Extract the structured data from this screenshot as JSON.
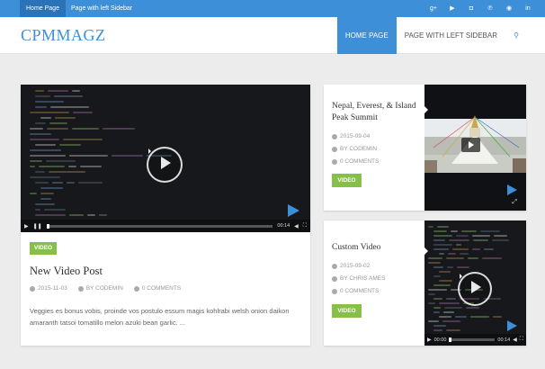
{
  "topbar": {
    "links": [
      "Home Page",
      "Page with left Sidebar"
    ],
    "social_icons": [
      "google-plus-icon",
      "youtube-icon",
      "instagram-icon",
      "pinterest-icon",
      "dribbble-icon",
      "linkedin-icon"
    ],
    "social_glyphs": [
      "g+",
      "▶",
      "◘",
      "℗",
      "◉",
      "in"
    ]
  },
  "header": {
    "logo": "CPMMAGZ",
    "nav": [
      "HOME PAGE",
      "PAGE WITH LEFT SIDEBAR"
    ],
    "search_glyph": "⚲"
  },
  "colors": {
    "accent": "#3d8fd8",
    "badge": "#86c04b"
  },
  "main_post": {
    "badge": "VIDEO",
    "title": "New Video Post",
    "date": "2015-11-03",
    "author": "BY CODEMIN",
    "comments": "0 COMMENTS",
    "excerpt": "Veggies es bonus vobis, proinde vos postulo essum magis kohlrabi welsh onion daikon amaranth tatsoi tomatillo melon azuki bean garlic. ...",
    "video": {
      "time": "00:14"
    }
  },
  "side_posts": [
    {
      "title": "Nepal, Everest, & Island Peak Summit",
      "date": "2015-09-04",
      "author": "BY CODEMIN",
      "comments": "0 COMMENTS",
      "badge": "VIDEO"
    },
    {
      "title": "Custom Video",
      "date": "2015-09-02",
      "author": "BY CHRIS AMES",
      "comments": "0 COMMENTS",
      "badge": "VIDEO",
      "video": {
        "time_start": "00:00",
        "time_end": "00:14"
      }
    }
  ]
}
